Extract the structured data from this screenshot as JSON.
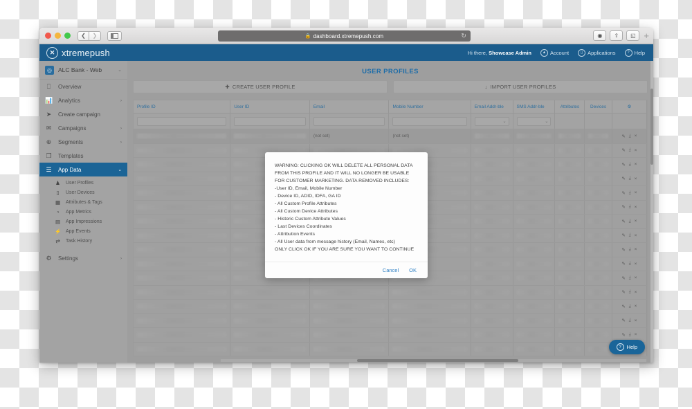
{
  "browser": {
    "url": "dashboard.xtremepush.com",
    "lock_icon": "lock-icon",
    "reload_icon": "reload-icon",
    "back_icon": "chevron-left-icon",
    "forward_icon": "chevron-right-icon",
    "sidebar_toggle_icon": "sidebar-toggle-icon",
    "toolbar_buttons": [
      {
        "name": "privacy-report-icon",
        "glyph": "◉"
      },
      {
        "name": "share-icon",
        "glyph": "⇧"
      },
      {
        "name": "tab-overview-icon",
        "glyph": "◱"
      }
    ],
    "new_tab_label": "+"
  },
  "appnav": {
    "brand": "xtremepush",
    "brand_mark_icon": "xtremepush-logo-icon",
    "greeting_prefix": "Hi there,",
    "user_name": "Showcase Admin",
    "items": [
      {
        "label": "Account",
        "icon": "user-icon",
        "glyph": "▲"
      },
      {
        "label": "Applications",
        "icon": "applications-icon",
        "glyph": "▯"
      },
      {
        "label": "Help",
        "icon": "help-icon",
        "glyph": "?"
      }
    ]
  },
  "sidebar": {
    "app_selector": {
      "name": "ALC Bank - Web",
      "logo_icon": "app-logo-icon",
      "chevron_icon": "chevron-down-icon"
    },
    "items": [
      {
        "label": "Overview",
        "icon": "monitor-icon",
        "glyph": "▭",
        "caret": "",
        "active": false
      },
      {
        "label": "Analytics",
        "icon": "bar-chart-icon",
        "glyph": "▄",
        "caret": "›",
        "active": false
      },
      {
        "label": "Create campaign",
        "icon": "paper-plane-icon",
        "glyph": "➤",
        "caret": "",
        "active": false
      },
      {
        "label": "Campaigns",
        "icon": "envelope-icon",
        "glyph": "✉",
        "caret": "›",
        "active": false
      },
      {
        "label": "Segments",
        "icon": "target-icon",
        "glyph": "⊕",
        "caret": "›",
        "active": false
      },
      {
        "label": "Templates",
        "icon": "layers-icon",
        "glyph": "❐",
        "caret": "",
        "active": false
      },
      {
        "label": "App Data",
        "icon": "list-icon",
        "glyph": "☰",
        "caret": "⌄",
        "active": true
      }
    ],
    "subitems": [
      {
        "label": "User Profiles",
        "icon": "person-icon",
        "glyph": "♟"
      },
      {
        "label": "User Devices",
        "icon": "mobile-icon",
        "glyph": "▯"
      },
      {
        "label": "Attributes & Tags",
        "icon": "tags-icon",
        "glyph": "▦"
      },
      {
        "label": "App Metrics",
        "icon": "metrics-icon",
        "glyph": "◔"
      },
      {
        "label": "App Impressions",
        "icon": "impressions-icon",
        "glyph": "▤"
      },
      {
        "label": "App Events",
        "icon": "bolt-icon",
        "glyph": "⚡"
      },
      {
        "label": "Task History",
        "icon": "history-icon",
        "glyph": "⇄"
      }
    ],
    "footer_items": [
      {
        "label": "Settings",
        "icon": "gear-icon",
        "glyph": "⚙",
        "caret": "›"
      }
    ]
  },
  "main": {
    "page_title": "USER PROFILES",
    "actions": [
      {
        "label": "CREATE USER PROFILE",
        "icon": "plus-icon",
        "glyph": "+"
      },
      {
        "label": "IMPORT USER PROFILES",
        "icon": "import-icon",
        "glyph": "⤓"
      }
    ],
    "table": {
      "columns": [
        {
          "label": "Profile ID",
          "filter": "input"
        },
        {
          "label": "User ID",
          "filter": "input"
        },
        {
          "label": "Email",
          "filter": "input"
        },
        {
          "label": "Mobile Number",
          "filter": "input"
        },
        {
          "label": "Email Addr-ble",
          "filter": "select"
        },
        {
          "label": "SMS Addr-ble",
          "filter": "select"
        },
        {
          "label": "Attributes",
          "filter": "none"
        },
        {
          "label": "Devices",
          "filter": "none"
        },
        {
          "label": "",
          "filter": "none",
          "icon": "gear-icon",
          "glyph": "⚙"
        }
      ],
      "filter_placeholders": [
        "",
        "",
        "",
        "",
        "",
        ""
      ],
      "not_set_label": "(not set)",
      "row_actions": [
        {
          "name": "edit-row-icon",
          "glyph": "✎"
        },
        {
          "name": "export-profile-icon",
          "glyph": "⤓"
        },
        {
          "name": "delete-row-icon",
          "glyph": "×"
        }
      ],
      "row_count": 16
    }
  },
  "modal": {
    "lines": [
      "WARNING: CLICKING OK WILL DELETE ALL PERSONAL DATA",
      "FROM THIS PROFILE AND IT WILL NO LONGER BE USABLE",
      "FOR CUSTOMER MARKETING. DATA REMOVED INCLUDES:",
      " -User ID, Email, Mobile Number",
      " - Device ID, ADID, IDFA, GA ID",
      " - All Custom Profile Attributes",
      " - All Custom Device Attributes",
      " - Historic Custom Attribute Values",
      " - Last Devices Coordinates",
      " - Attribution Events",
      " - All User data from message history  (Email, Names, etc)",
      "ONLY CLICK OK IF YOU ARE SURE YOU WANT TO CONTINUE"
    ],
    "cancel_label": "Cancel",
    "ok_label": "OK"
  },
  "help_widget": {
    "label": "Help",
    "icon": "question-circle-icon"
  },
  "colors": {
    "brand_blue": "#1b5c8c",
    "accent_blue": "#1c6ca8",
    "link_blue": "#2d7fc4",
    "sidebar_active": "#1b6496"
  }
}
